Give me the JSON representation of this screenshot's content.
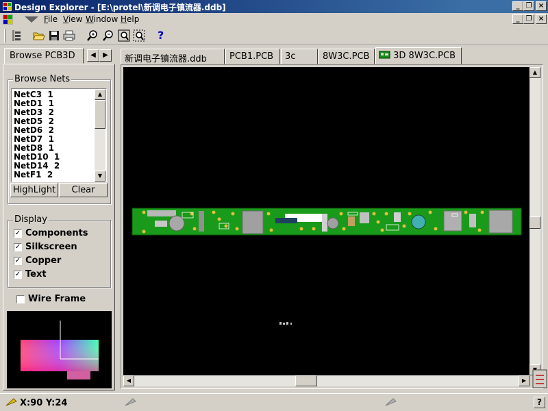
{
  "window": {
    "title": "Design Explorer - [E:\\protel\\新调电子镇流器.ddb]",
    "caption_buttons": [
      "_",
      "❐",
      "×"
    ],
    "doc_buttons": [
      "_",
      "❐",
      "×"
    ]
  },
  "menu": {
    "items": [
      {
        "label": "File"
      },
      {
        "label": "View"
      },
      {
        "label": "Window"
      },
      {
        "label": "Help"
      }
    ]
  },
  "toolbar": {
    "icons": [
      "explorer-icon",
      "open-folder-icon",
      "save-icon",
      "print-icon",
      "zoom-in-icon",
      "zoom-out-icon",
      "zoom-fit-icon",
      "zoom-area-icon",
      "help-icon"
    ],
    "help_glyph": "?"
  },
  "left_panel": {
    "tab_label": "Browse PCB3D",
    "tab_arrows": [
      "◀",
      "▶"
    ],
    "browse_nets_label": "Browse Nets",
    "nets": [
      "NetC3  1",
      "NetD1  1",
      "NetD3  2",
      "NetD5  2",
      "NetD6  2",
      "NetD7  1",
      "NetD8  1",
      "NetD10  1",
      "NetD14  2",
      "NetF1  2"
    ],
    "highlight_button": "HighLight",
    "clear_button": "Clear",
    "display_label": "Display",
    "display_options": [
      {
        "label": "Components",
        "checked": true
      },
      {
        "label": "Silkscreen",
        "checked": true
      },
      {
        "label": "Copper",
        "checked": true
      },
      {
        "label": "Text",
        "checked": true
      }
    ],
    "wireframe": {
      "label": "Wire Frame",
      "checked": false
    },
    "check_glyph": "✓"
  },
  "tabs": [
    {
      "label": "新调电子镇流器.ddb",
      "active": false
    },
    {
      "label": "PCB1.PCB",
      "active": false
    },
    {
      "label": "3c",
      "active": false
    },
    {
      "label": "8W3C.PCB",
      "active": false
    },
    {
      "label": "3D 8W3C.PCB",
      "active": true
    }
  ],
  "status": {
    "coords": "X:90 Y:24",
    "help_glyph": "?"
  },
  "colors": {
    "title_start": "#0a246a",
    "board_green": "#1a9a1a",
    "viewport_bg": "#000000",
    "face": "#d4d0c8"
  }
}
